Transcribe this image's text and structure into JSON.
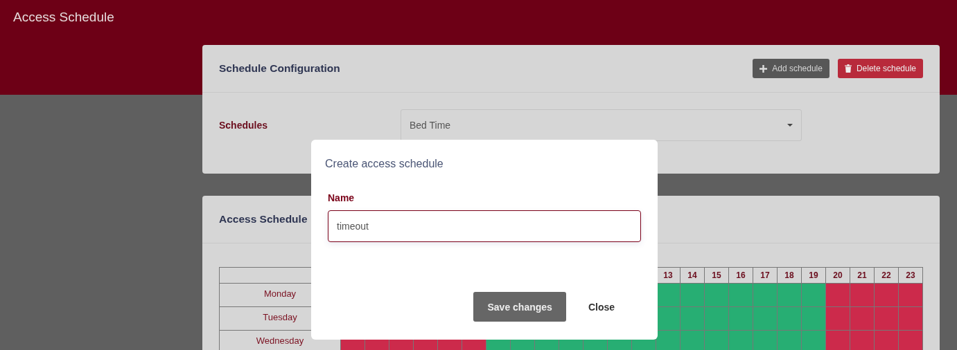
{
  "header": {
    "title": "Access Schedule"
  },
  "config_card": {
    "title": "Schedule Configuration",
    "add_button": "Add schedule",
    "delete_button": "Delete schedule",
    "schedules_label": "Schedules",
    "schedules_value": "Bed Time"
  },
  "schedule_card": {
    "title": "Access Schedule",
    "hour_columns": [
      "13",
      "14",
      "15",
      "16",
      "17",
      "18",
      "19",
      "20",
      "21",
      "22",
      "23"
    ],
    "rows": [
      {
        "day": "Monday",
        "allowed": [
          true,
          true,
          true,
          true,
          true,
          true,
          true,
          false,
          false,
          false,
          false
        ]
      },
      {
        "day": "Tuesday",
        "allowed": [
          true,
          true,
          true,
          true,
          true,
          true,
          true,
          false,
          false,
          false,
          false
        ]
      },
      {
        "day": "Wednesday",
        "allowed": [
          false,
          false,
          false,
          false,
          false,
          false,
          true,
          true,
          true,
          true,
          true,
          true,
          true,
          true,
          true,
          true,
          true,
          true,
          true,
          true,
          false,
          false,
          false,
          false
        ]
      }
    ]
  },
  "dialog": {
    "title": "Create access schedule",
    "name_label": "Name",
    "name_value": "timeout",
    "save_button": "Save changes",
    "close_button": "Close"
  }
}
